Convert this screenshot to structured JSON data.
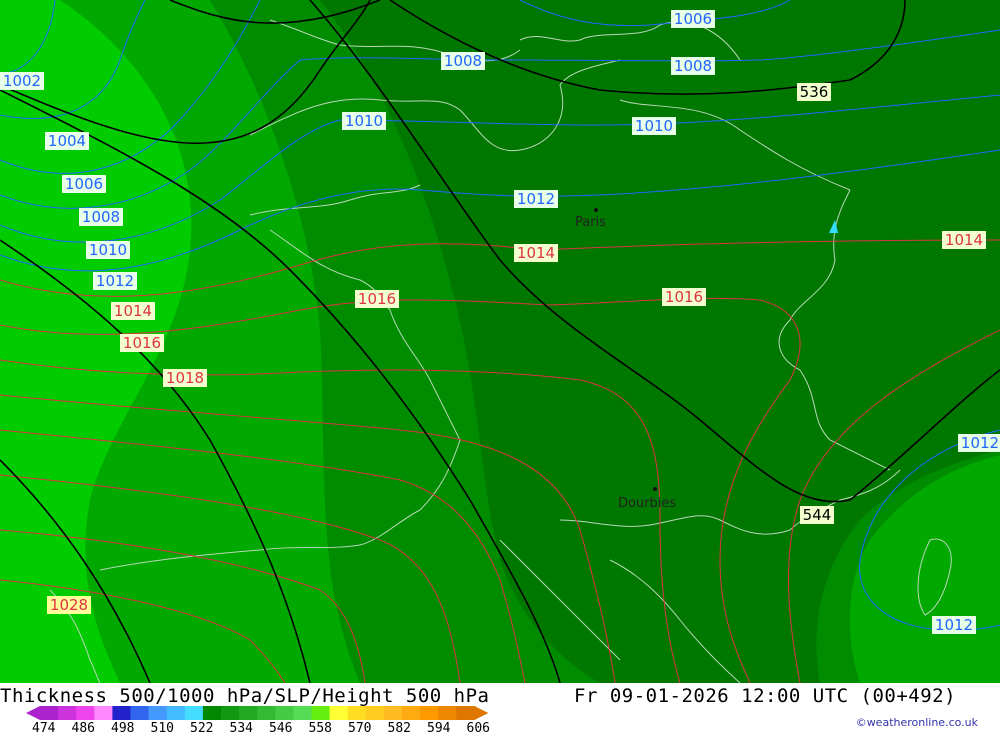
{
  "title": "Thickness 500/1000 hPa/SLP/Height 500 hPa",
  "datetime": "Fr 09-01-2026 12:00 UTC (00+492)",
  "credit": "©weatheronline.co.uk",
  "legend": {
    "values": [
      "474",
      "486",
      "498",
      "510",
      "522",
      "534",
      "546",
      "558",
      "570",
      "582",
      "594",
      "606"
    ],
    "colors": [
      "#aa22cc",
      "#cc33dd",
      "#ee44ee",
      "#ff88ff",
      "#2222cc",
      "#3366ee",
      "#4499ff",
      "#44bbff",
      "#44ddff",
      "#008800",
      "#119911",
      "#22aa22",
      "#33bb33",
      "#44cc44",
      "#55dd55",
      "#66ee11",
      "#ffff33",
      "#ffdd22",
      "#ffcc22",
      "#ffbb22",
      "#ffaa11",
      "#ff9900",
      "#ee8800",
      "#dd7700"
    ]
  },
  "map_colors": {
    "zone_light": "#00cc00",
    "zone_mid": "#00a800",
    "zone_dark": "#008c00",
    "zone_darkest": "#007800",
    "slp_low": "#2266ff",
    "slp_high": "#dd3344",
    "height": "#000000"
  },
  "isobar_labels": [
    {
      "text": "1006",
      "kind": "low"
    },
    {
      "text": "1008",
      "kind": "low"
    },
    {
      "text": "1008",
      "kind": "low"
    },
    {
      "text": "1010",
      "kind": "low"
    },
    {
      "text": "1010",
      "kind": "low"
    },
    {
      "text": "1012",
      "kind": "low"
    },
    {
      "text": "1002",
      "kind": "low"
    },
    {
      "text": "1004",
      "kind": "low"
    },
    {
      "text": "1006",
      "kind": "low"
    },
    {
      "text": "1008",
      "kind": "low"
    },
    {
      "text": "1010",
      "kind": "low"
    },
    {
      "text": "1012",
      "kind": "low"
    },
    {
      "text": "1014",
      "kind": "high"
    },
    {
      "text": "1014",
      "kind": "high"
    },
    {
      "text": "1014",
      "kind": "high"
    },
    {
      "text": "1016",
      "kind": "high"
    },
    {
      "text": "1016",
      "kind": "high"
    },
    {
      "text": "1016",
      "kind": "high"
    },
    {
      "text": "1018",
      "kind": "high"
    },
    {
      "text": "1028",
      "kind": "high"
    },
    {
      "text": "1012",
      "kind": "low"
    },
    {
      "text": "1012",
      "kind": "low"
    }
  ],
  "height_labels": [
    {
      "text": "536"
    },
    {
      "text": "544"
    }
  ],
  "places": [
    {
      "name": "Paris"
    },
    {
      "name": "Dourbies"
    }
  ]
}
